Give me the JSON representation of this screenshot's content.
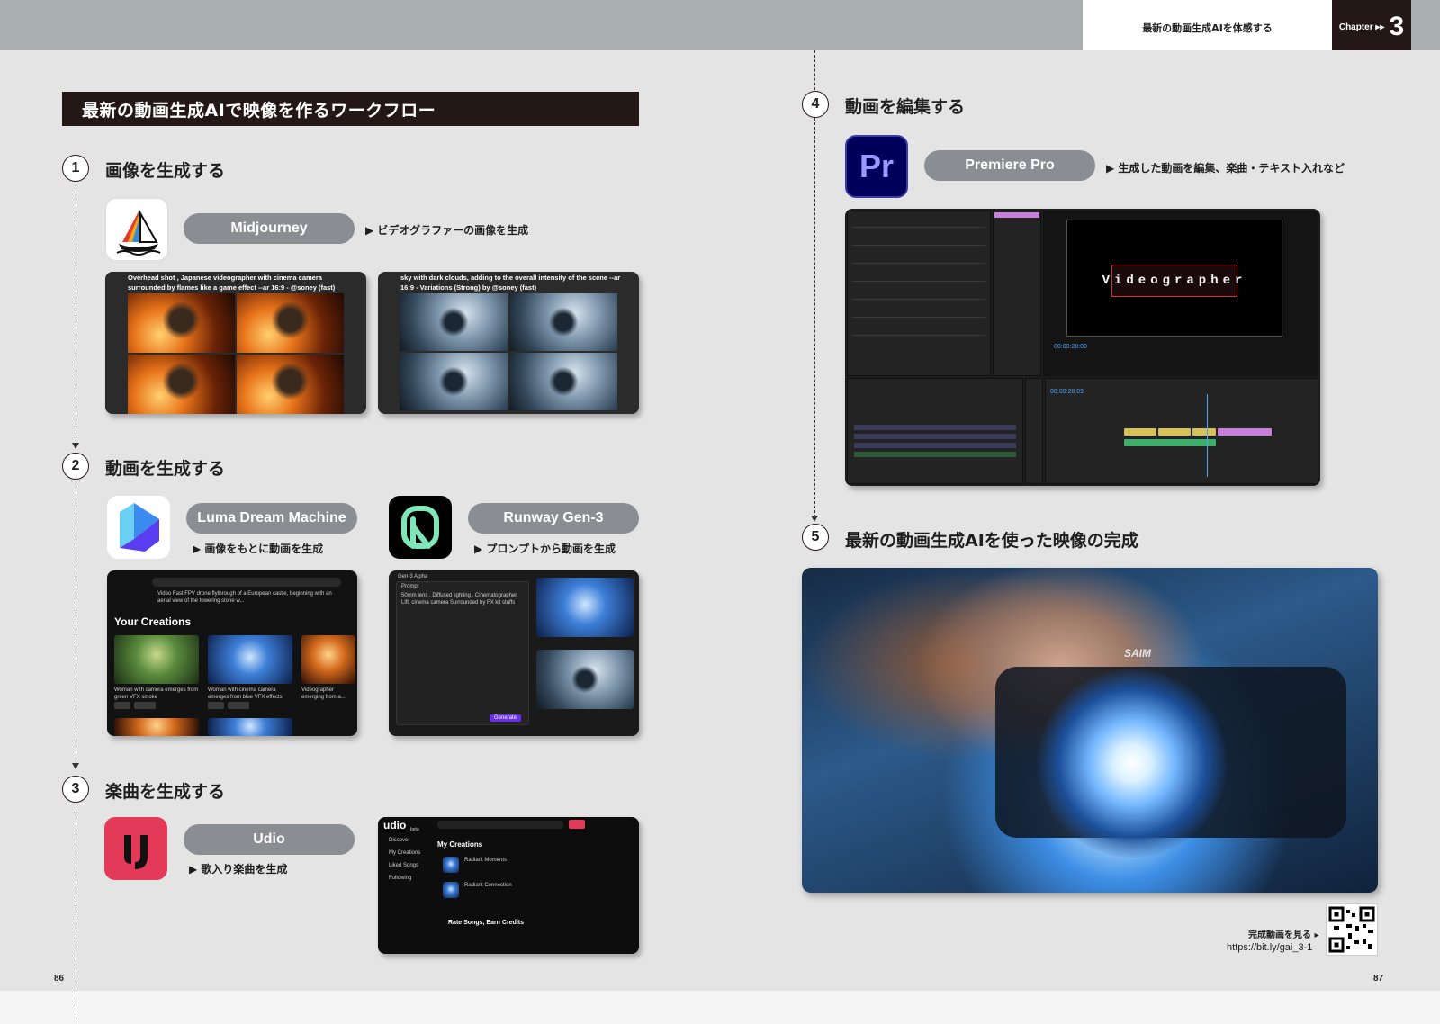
{
  "header": {
    "running_title": "最新の動画生成AIを体感する",
    "chapter_word": "Chapter ▸▸",
    "chapter_number": "3"
  },
  "workflow_title": "最新の動画生成AIで映像を作るワークフロー",
  "steps": [
    {
      "number": "1",
      "title": "画像を生成する"
    },
    {
      "number": "2",
      "title": "動画を生成する"
    },
    {
      "number": "3",
      "title": "楽曲を生成する"
    },
    {
      "number": "4",
      "title": "動画を編集する"
    },
    {
      "number": "5",
      "title": "最新の動画生成AIを使った映像の完成"
    }
  ],
  "tools": {
    "midjourney": {
      "name": "Midjourney",
      "desc": "▶ ビデオグラファーの画像を生成"
    },
    "luma": {
      "name": "Luma Dream Machine",
      "desc": "▶ 画像をもとに動画を生成"
    },
    "runway": {
      "name": "Runway Gen-3",
      "desc": "▶ プロンプトから動画を生成"
    },
    "udio": {
      "name": "Udio",
      "desc": "▶ 歌入り楽曲を生成"
    },
    "premiere": {
      "name": "Premiere Pro",
      "desc": "▶ 生成した動画を編集、楽曲・テキスト入れなど",
      "icon_text": "Pr"
    }
  },
  "screenshots": {
    "mj_fire_caption": "Overhead shot , Japanese videographer with cinema camera surrounded by flames like a game effect --ar 16:9 - @soney (fast)",
    "mj_ice_caption": "sky with dark clouds, adding to the overall intensity of the scene --ar 16:9 - Variations (Strong) by @soney (fast)",
    "luma_heading": "Your Creations",
    "luma_prompt": "Video  Fast FPV drone flythrough of a European castle, beginning with an aerial view of the towering stone w...",
    "luma_items": [
      "Woman with camera emerges from green VFX smoke",
      "Woman with cinema camera emerges from blue VFX effects",
      "Videographer emerging from a..."
    ],
    "runway_model": "Gen-3 Alpha",
    "runway_prompt_label": "Prompt",
    "runway_prompt": "50mm lens , Diffused lighting , Cinematographer. Lift, cinema camera Surrounded by FX kit stuffs",
    "runway_button": "Generate",
    "udio_logo": "udio",
    "udio_beta": "beta",
    "udio_section": "My Creations",
    "udio_tracks": [
      "Radiant Moments",
      "Radiant Connection"
    ],
    "udio_nav": [
      "Discover",
      "My Creations",
      "Liked Songs",
      "Following"
    ],
    "udio_banner": "Rate Songs, Earn Credits",
    "premiere_timecode": "00:00:28:09",
    "premiere_title_text": "Videographer"
  },
  "qr": {
    "label": "完成動画を見る ▸",
    "url": "https://bit.ly/gai_3-1"
  },
  "page_numbers": {
    "left": "86",
    "right": "87"
  }
}
